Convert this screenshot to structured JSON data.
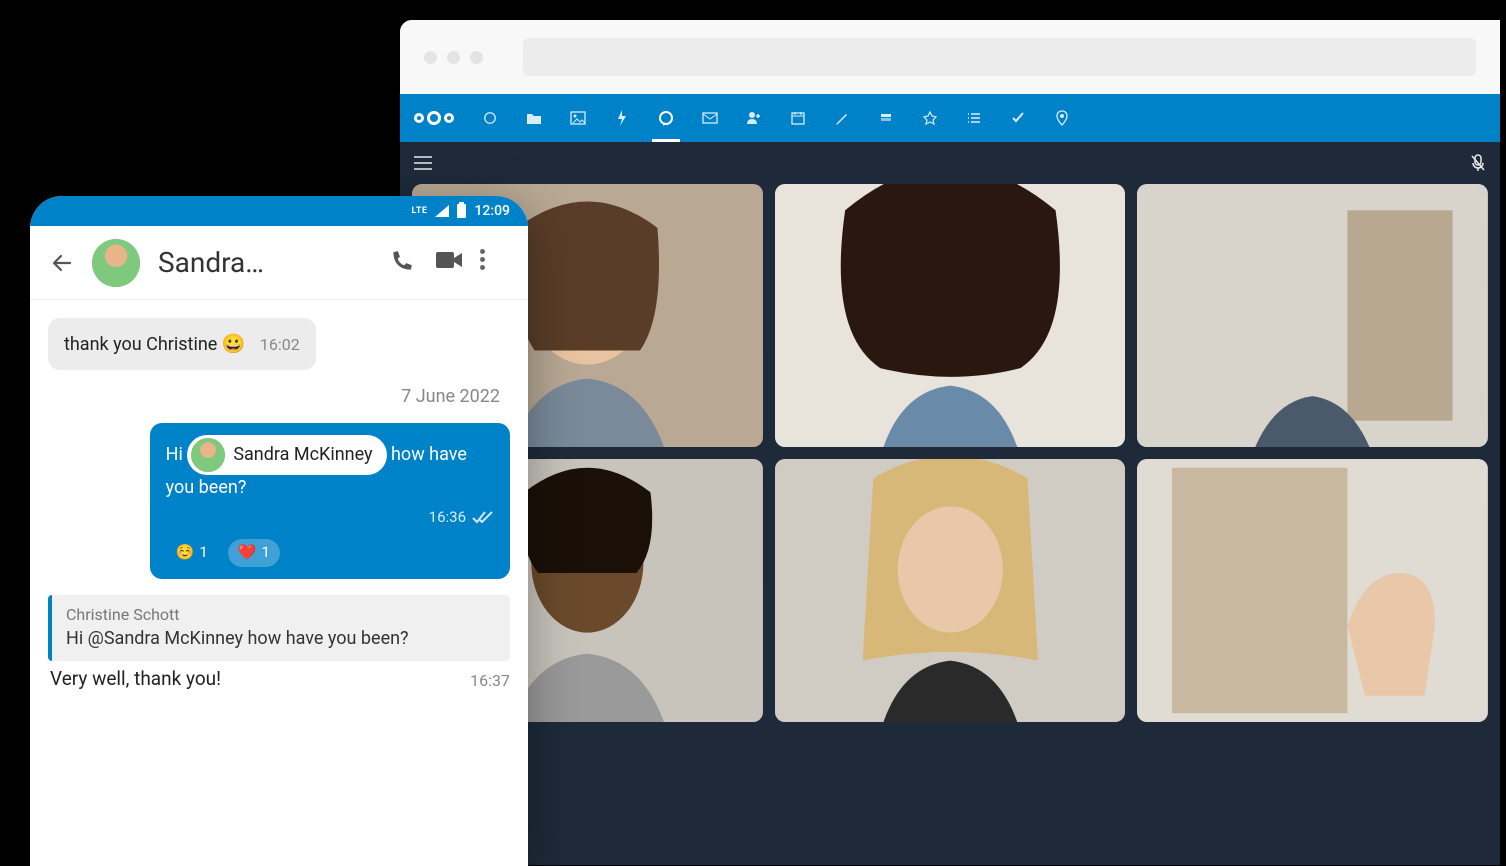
{
  "browser": {
    "nav_icons": [
      "dashboard",
      "files",
      "photos",
      "activity",
      "talk",
      "mail",
      "contacts",
      "calendar",
      "notes",
      "deck",
      "recipes",
      "tasks-list",
      "tasks-check",
      "maps"
    ]
  },
  "call": {
    "participants": [
      "Participant 1",
      "Participant 2",
      "Participant 3",
      "Participant 4",
      "Participant 5",
      "Participant 6"
    ]
  },
  "phone": {
    "status": {
      "network": "LTE",
      "time": "12:09"
    },
    "chat_title": "Sandra…",
    "messages": {
      "m1": {
        "text": "thank you Christine ",
        "emoji": "😀",
        "time": "16:02"
      },
      "date_sep": "7 June 2022",
      "m2": {
        "prefix": "Hi ",
        "mention": "Sandra McKinney",
        "suffix": " how have you been?",
        "time": "16:36",
        "reactions": [
          {
            "emoji": "☺️",
            "count": "1"
          },
          {
            "emoji": "❤️",
            "count": "1"
          }
        ]
      },
      "m3": {
        "reply_author": "Christine Schott",
        "reply_text": "Hi  @Sandra McKinney  how have you been?",
        "text": "Very well, thank you!",
        "time": "16:37"
      }
    }
  }
}
